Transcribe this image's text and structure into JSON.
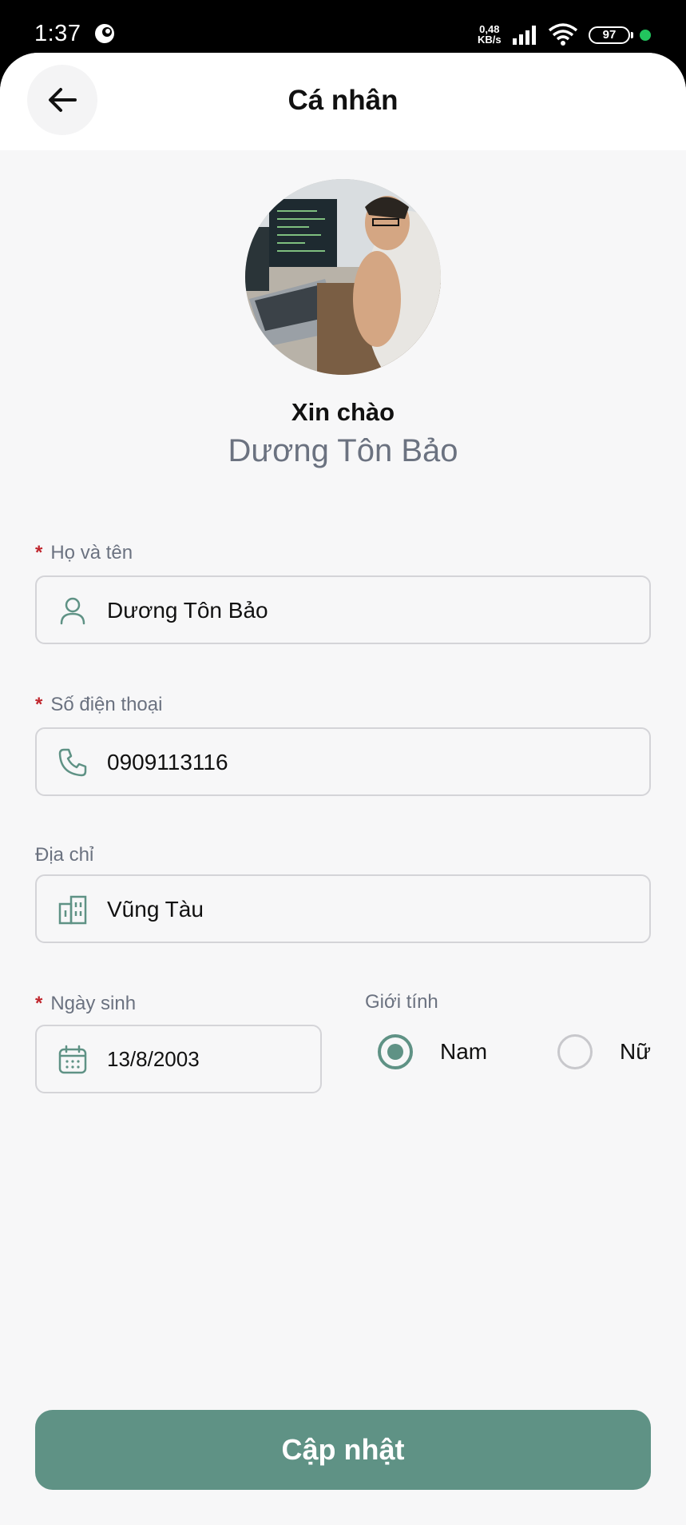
{
  "status_bar": {
    "time": "1:37",
    "net_speed_value": "0,48",
    "net_speed_unit": "KB/s",
    "battery": "97"
  },
  "header": {
    "title": "Cá nhân"
  },
  "profile": {
    "greeting": "Xin chào",
    "name": "Dương Tôn Bảo"
  },
  "form": {
    "required_mark": "*",
    "full_name": {
      "label": "Họ và tên",
      "value": "Dương Tôn Bảo",
      "icon": "user-icon"
    },
    "phone": {
      "label": "Số điện thoại",
      "value": "0909113116",
      "icon": "phone-icon"
    },
    "address": {
      "label": "Địa chỉ",
      "value": "Vũng Tàu",
      "icon": "building-icon"
    },
    "birthday": {
      "label": "Ngày sinh",
      "value": "13/8/2003",
      "icon": "calendar-icon"
    },
    "gender": {
      "label": "Giới tính",
      "options": [
        "Nam",
        "Nữ"
      ],
      "selected": "Nam"
    }
  },
  "actions": {
    "update_label": "Cập nhật"
  },
  "colors": {
    "accent": "#5f9285",
    "required": "#c0262d",
    "label": "#6b7280"
  }
}
